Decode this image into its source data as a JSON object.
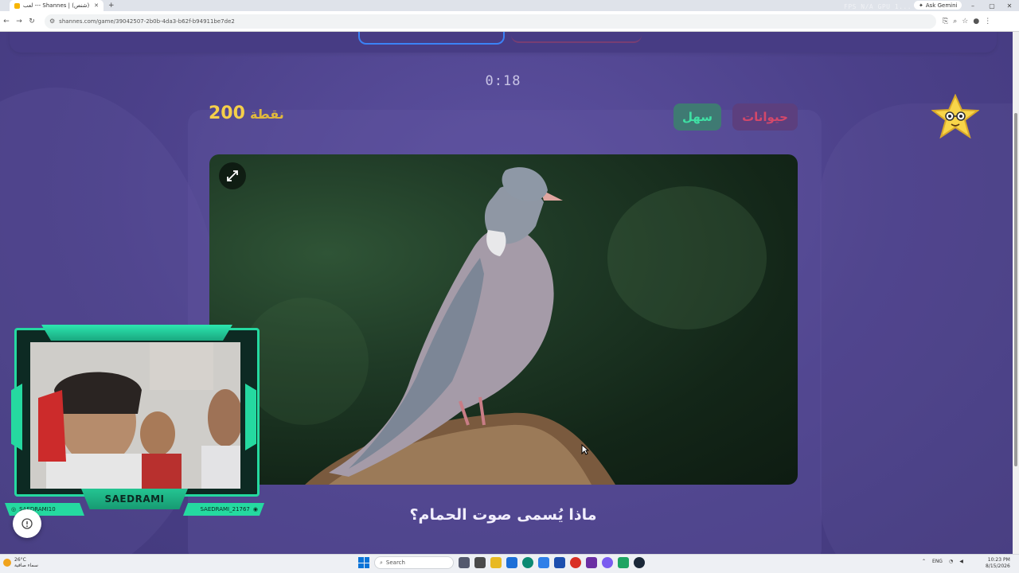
{
  "browser": {
    "tab_title": "لعب --- Shannes | (شنص) بنص",
    "new_tab": "+",
    "url": "shannes.com/game/39042507-2b0b-4da3-b62f-b94911be7de2",
    "gemini_label": "Ask Gemini",
    "overlay_stats": "FPS N/A  GPU 1..."
  },
  "game": {
    "timer": "0:18",
    "points_value": "200",
    "points_unit": "نقطة",
    "difficulty": "سهل",
    "category": "حيوانات",
    "question": "ماذا يُسمى صوت الحمام؟"
  },
  "stream_overlay": {
    "streamer_name": "SAEDRAMI",
    "handle_left": "SAEDRAMI10",
    "handle_right": "SAEDRAMI_21767"
  },
  "taskbar": {
    "weather_temp": "26°C",
    "weather_desc": "سماء صافية",
    "search_placeholder": "Search",
    "language": "ENG",
    "time": "10:23 PM",
    "date": "8/15/2026"
  },
  "colors": {
    "background": "#4a3f86",
    "points": "#f5cf4a",
    "easy_chip_text": "#3fe0a4",
    "category_chip_text": "#d4486a",
    "overlay_accent": "#25d9a0"
  }
}
